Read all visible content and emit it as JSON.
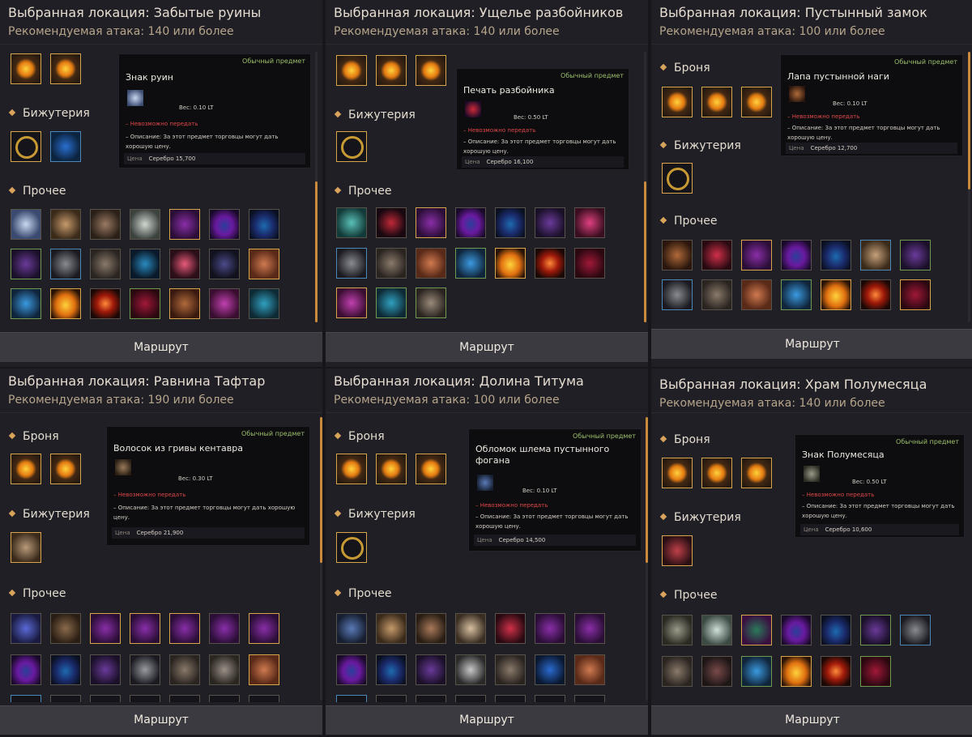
{
  "route_label": "Маршрут",
  "info_prefix": "Обычный предмет",
  "weight_label": "Вес:",
  "untradable": "– Невозможно передать",
  "description": "– Описание: За этот предмет торговцы могут дать хорошую цену.",
  "price_label": "Цена",
  "sections": {
    "armor": "Броня",
    "jewelry": "Бижутерия",
    "other": "Прочее"
  },
  "panels": [
    {
      "location": "Выбранная локация: Забытые руины",
      "attack": "Рекомендуемая атака: 140 или более",
      "item_name": "Знак руин",
      "weight": "0.10 LT",
      "price": "Серебро 15,700"
    },
    {
      "location": "Выбранная локация: Ущелье разбойников",
      "attack": "Рекомендуемая атака: 140 или более",
      "item_name": "Печать разбойника",
      "weight": "0.50 LT",
      "price": "Серебро 16,100"
    },
    {
      "location": "Выбранная локация: Пустынный замок",
      "attack": "Рекомендуемая атака: 100 или более",
      "item_name": "Лапа пустынной наги",
      "weight": "0.10 LT",
      "price": "Серебро 12,700"
    },
    {
      "location": "Выбранная локация: Равнина Тафтар",
      "attack": "Рекомендуемая атака: 190 или более",
      "item_name": "Волосок из гривы кентавра",
      "weight": "0.30 LT",
      "price": "Серебро 21,900"
    },
    {
      "location": "Выбранная локация: Долина Титума",
      "attack": "Рекомендуемая атака: 100 или более",
      "item_name": "Обломок шлема пустынного фогана",
      "weight": "0.10 LT",
      "price": "Серебро 14,500"
    },
    {
      "location": "Выбранная локация: Храм Полумесяца",
      "attack": "Рекомендуемая атака: 140 или более",
      "item_name": "Знак Полумесяца",
      "weight": "0.50 LT",
      "price": "Серебро 10,600"
    }
  ],
  "colors": {
    "accent": "#d7a64b",
    "route_bg": "#3b3a41",
    "untradable": "#e04848",
    "item_type": "#9bbf6a"
  }
}
